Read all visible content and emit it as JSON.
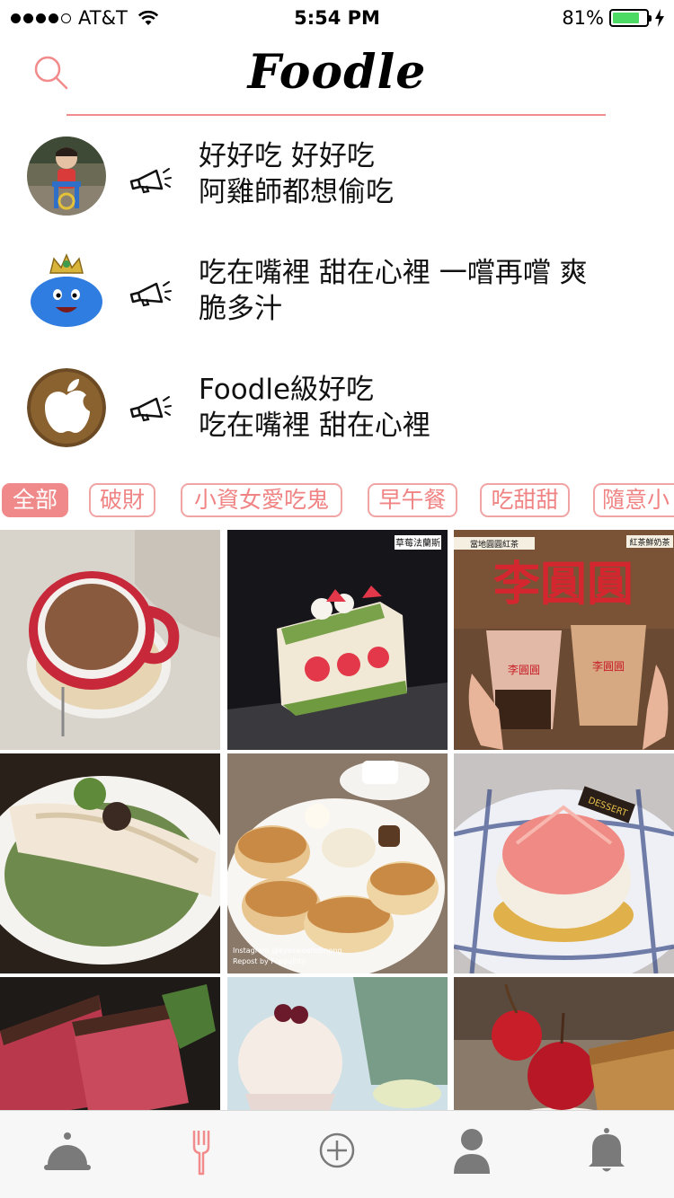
{
  "status_bar": {
    "carrier": "AT&T",
    "time": "5:54 PM",
    "battery": "81%",
    "battery_level": 0.81,
    "signal_bars": 4
  },
  "header": {
    "title": "Foodle",
    "search_icon": "search-icon",
    "accent_color": "#f28b8b"
  },
  "feed": [
    {
      "avatar": "child-photo-avatar",
      "icon": "megaphone-icon",
      "line1": "好好吃 好好吃",
      "line2": "阿雞師都想偷吃"
    },
    {
      "avatar": "slime-king-avatar",
      "icon": "megaphone-icon",
      "line1": "吃在嘴裡 甜在心裡 一嚐再嚐 爽",
      "line2": "脆多汁"
    },
    {
      "avatar": "apple-logo-avatar",
      "icon": "megaphone-icon",
      "line1": "Foodle級好吃",
      "line2": "吃在嘴裡 甜在心裡"
    }
  ],
  "categories": [
    {
      "label": "全部",
      "active": true
    },
    {
      "label": "破財",
      "active": false
    },
    {
      "label": "小資女愛吃鬼",
      "active": false
    },
    {
      "label": "早午餐",
      "active": false
    },
    {
      "label": "吃甜甜",
      "active": false
    },
    {
      "label": "隨意小",
      "active": false
    }
  ],
  "photos": [
    {
      "subject": "hot-chocolate-photo"
    },
    {
      "subject": "strawberry-cake-photo",
      "watermark": "草莓法蘭斯"
    },
    {
      "subject": "bubble-tea-photo",
      "sign": "李圓圓",
      "tag_left": "當地圓圓紅茶",
      "tag_right": "紅茶鮮奶茶",
      "cup_label": "李圓圓"
    },
    {
      "subject": "salmon-risotto-photo"
    },
    {
      "subject": "souffle-pancake-photo",
      "caption1": "Instagram @eyesweetsdmong",
      "caption2": "Repost by Foppullity"
    },
    {
      "subject": "dessert-bun-photo",
      "tag": "DESSERT"
    },
    {
      "subject": "steak-photo"
    },
    {
      "subject": "shaved-ice-photo"
    },
    {
      "subject": "cherry-cake-photo"
    }
  ],
  "tab_bar": [
    {
      "icon": "cloche-icon",
      "active": false
    },
    {
      "icon": "fork-icon",
      "active": true
    },
    {
      "icon": "add-icon",
      "active": false
    },
    {
      "icon": "profile-icon",
      "active": false
    },
    {
      "icon": "bell-icon",
      "active": false
    }
  ]
}
